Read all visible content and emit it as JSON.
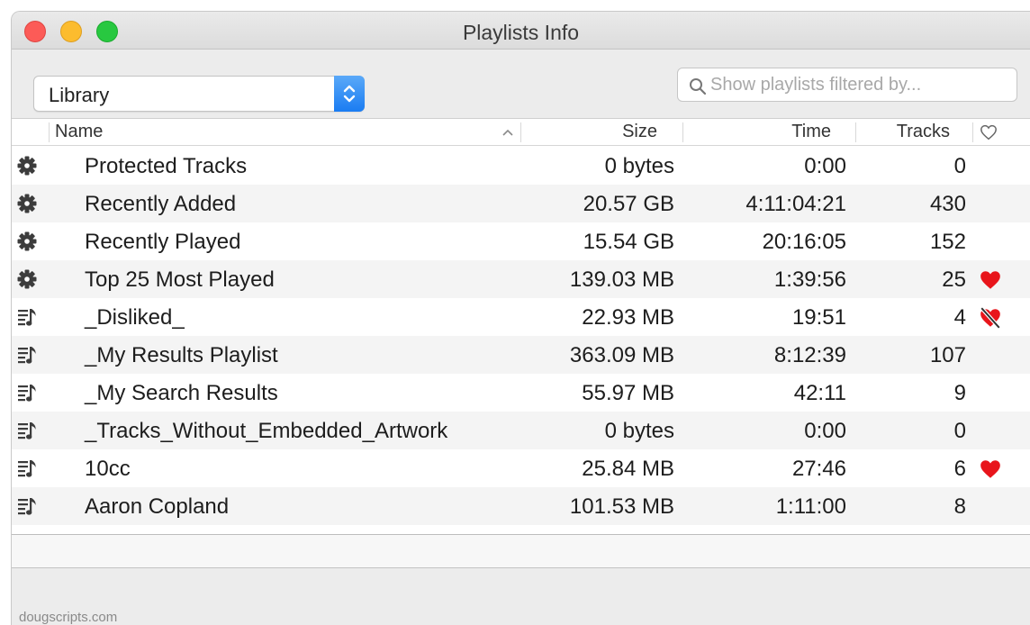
{
  "window": {
    "title": "Playlists Info"
  },
  "toolbar": {
    "source_selected": "Library",
    "search_placeholder": "Show playlists filtered by...",
    "search_value": ""
  },
  "table": {
    "columns": {
      "name": "Name",
      "size": "Size",
      "time": "Time",
      "tracks": "Tracks",
      "loved_icon": "heart-outline-icon"
    },
    "sort_column": "name",
    "sort_direction": "ascending",
    "rows": [
      {
        "icon": "gear-icon",
        "name": "Protected Tracks",
        "size": "0 bytes",
        "time": "0:00",
        "tracks": "0",
        "loved": "none"
      },
      {
        "icon": "gear-icon",
        "name": "Recently Added",
        "size": "20.57 GB",
        "time": "4:11:04:21",
        "tracks": "430",
        "loved": "none"
      },
      {
        "icon": "gear-icon",
        "name": "Recently Played",
        "size": "15.54 GB",
        "time": "20:16:05",
        "tracks": "152",
        "loved": "none"
      },
      {
        "icon": "gear-icon",
        "name": "Top 25 Most Played",
        "size": "139.03 MB",
        "time": "1:39:56",
        "tracks": "25",
        "loved": "loved"
      },
      {
        "icon": "playlist-icon",
        "name": "_Disliked_",
        "size": "22.93 MB",
        "time": "19:51",
        "tracks": "4",
        "loved": "disliked"
      },
      {
        "icon": "playlist-icon",
        "name": "_My Results Playlist",
        "size": "363.09 MB",
        "time": "8:12:39",
        "tracks": "107",
        "loved": "none"
      },
      {
        "icon": "playlist-icon",
        "name": "_My Search Results",
        "size": "55.97 MB",
        "time": "42:11",
        "tracks": "9",
        "loved": "none"
      },
      {
        "icon": "playlist-icon",
        "name": "_Tracks_Without_Embedded_Artwork",
        "size": "0 bytes",
        "time": "0:00",
        "tracks": "0",
        "loved": "none"
      },
      {
        "icon": "playlist-icon",
        "name": "10cc",
        "size": "25.84 MB",
        "time": "27:46",
        "tracks": "6",
        "loved": "loved"
      },
      {
        "icon": "playlist-icon",
        "name": "Aaron Copland",
        "size": "101.53 MB",
        "time": "1:11:00",
        "tracks": "8",
        "loved": "none"
      }
    ]
  },
  "footer": {
    "credit": "dougscripts.com"
  },
  "colors": {
    "close": "#fc5b57",
    "minimize": "#fcbc2e",
    "zoom": "#28c840",
    "accent": "#1a7cf2",
    "heart": "#e8151b",
    "row_alt": "#f4f4f4"
  }
}
